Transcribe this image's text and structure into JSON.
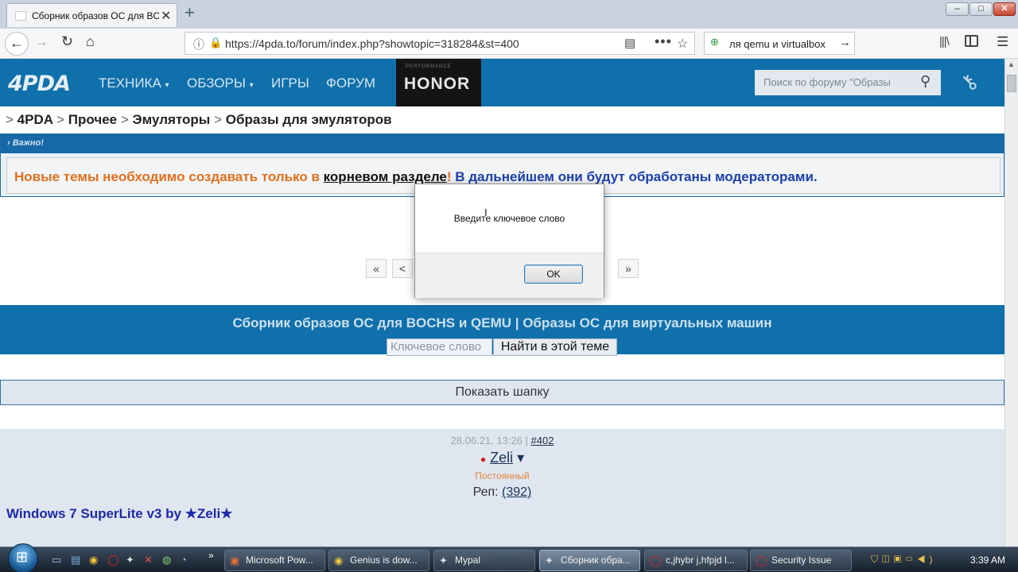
{
  "browser": {
    "tab_title": "Сборник образов ОС для BOCHS",
    "tab_close": "✕",
    "new_tab": "+",
    "window_controls": {
      "minimize": "–",
      "maximize": "□",
      "close": "✕"
    },
    "url": "https://4pda.to/forum/index.php?showtopic=318284&st=400",
    "search_value": "ля qemu и virtualbox",
    "icons": {
      "back": "←",
      "forward": "→",
      "reload": "↻",
      "home": "⌂",
      "info": "ⓘ",
      "lock": "🔒",
      "reader": "▤",
      "more": "•••",
      "star": "☆",
      "search_go": "→",
      "library": "|||\\",
      "menu": "☰"
    }
  },
  "site": {
    "logo": "4PDA",
    "nav": [
      {
        "label": "ТЕХНИКА",
        "caret": "▾"
      },
      {
        "label": "ОБЗОРЫ",
        "caret": "▾"
      },
      {
        "label": "ИГРЫ"
      },
      {
        "label": "ФОРУМ"
      }
    ],
    "banner": {
      "sub": "PERFORMANCE",
      "brand": "HONOR"
    },
    "search_placeholder": "Поиск по форуму \"Образы",
    "search_icon": "⚲",
    "login_icon": "⚷"
  },
  "breadcrumb": {
    "sep": ">",
    "items": [
      "4PDA",
      "Прочее",
      "Эмуляторы",
      "Образы для эмуляторов"
    ]
  },
  "important": {
    "title": "› Важно!",
    "part1": "Новые темы необходимо создавать только в ",
    "link": "корневом разделе",
    "part2": "! ",
    "part3": "В дальнейшем они будут обработаны модераторами."
  },
  "pagination": {
    "first": "«",
    "prev": "<",
    "next": "»"
  },
  "topic": {
    "title": "Сборник образов ОС для BOCHS и QEMU | Образы ОС для виртуальных машин",
    "search_placeholder": "Ключевое слово",
    "search_button": "Найти в этой теме"
  },
  "show_header": "Показать шапку",
  "post": {
    "date": "28.06.21, 13:26",
    "sep": " | ",
    "number": "#402",
    "author_dot": "●",
    "author": "Zeli",
    "author_caret": "▾",
    "status": "Постоянный",
    "rep_label": "Реп: ",
    "rep_value": "(392)",
    "subject": "Windows 7 SuperLite v3 by ★Zeli★"
  },
  "dialog": {
    "message": "Введите ключевое слово",
    "ok": "OK",
    "cursor": "I"
  },
  "taskbar": {
    "quicklaunch_more": "»",
    "buttons": [
      {
        "label": "Microsoft Pow...",
        "icon": "▣"
      },
      {
        "label": "Genius is dow...",
        "icon": "◉"
      },
      {
        "label": "Mypal",
        "icon": "✦"
      },
      {
        "label": "Сборник обра...",
        "icon": "✦"
      },
      {
        "label": "c,jhybr j,hfpjd l...",
        "icon": "◯"
      },
      {
        "label": "Security Issue",
        "icon": "◯"
      }
    ],
    "clock": "3:39 AM"
  }
}
